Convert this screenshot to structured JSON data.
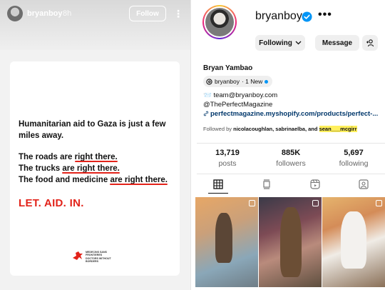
{
  "story": {
    "username": "bryanboy",
    "time": "8h",
    "follow_label": "Follow",
    "more_icon": "⋮",
    "card": {
      "headline": "Humanitarian aid to Gaza is just a few miles away.",
      "line1_pre": "The roads are ",
      "line1_u": "right there.",
      "line2_pre": "The trucks ",
      "line2_u": "are right there.",
      "line3_pre": "The food and medicine ",
      "line3_u": "are right there.",
      "slogan": "LET. AID. IN.",
      "org_line1": "MEDECINS SANS FRONTIERES",
      "org_line2": "DOCTORS WITHOUT BORDERS"
    }
  },
  "profile": {
    "username": "bryanboy",
    "more": "•••",
    "following_label": "Following",
    "message_label": "Message",
    "full_name": "Bryan Yambao",
    "threads_handle": "bryanboy",
    "threads_badge": "· 1 New",
    "bio_email": "📨 team@bryanboy.com",
    "bio_handle": "@ThePerfectMagazine",
    "bio_link": "perfectmagazine.myshopify.com/products/perfect-...",
    "followed_by_label": "Followed by ",
    "followed_by_names": "nicolacoughlan, sabrinaelba, and ",
    "followed_by_highlight": "sean___mcgirr",
    "stats": {
      "posts_value": "13,719",
      "posts_label": "posts",
      "followers_value": "885K",
      "followers_label": "followers",
      "following_value": "5,697",
      "following_label": "following"
    },
    "tabs": [
      "grid-icon",
      "feed-icon",
      "reels-icon",
      "tagged-icon"
    ],
    "colors": {
      "verified": "#0095f6",
      "link": "#00376b",
      "highlight": "#ffef5c",
      "slogan_red": "#e2231a"
    }
  }
}
